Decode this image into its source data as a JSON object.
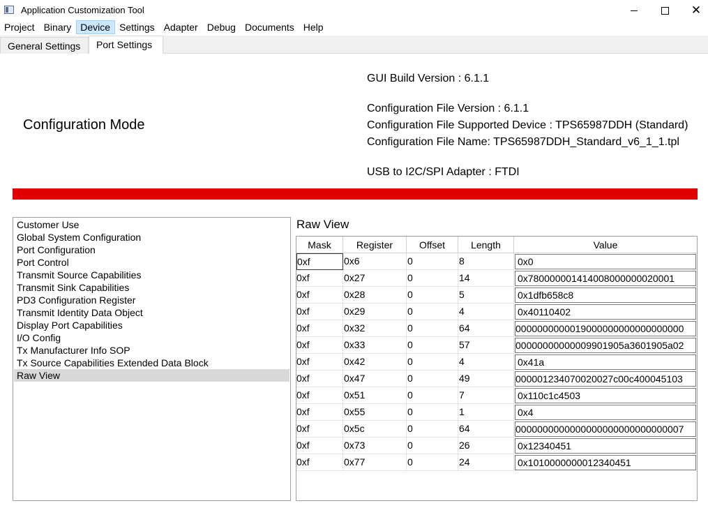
{
  "window": {
    "title": "Application Customization Tool",
    "icon": "app-window-icon",
    "controls": {
      "minimize": "minimize-icon",
      "maximize": "maximize-icon",
      "close": "✕"
    }
  },
  "menu": [
    "Project",
    "Binary",
    "Device",
    "Settings",
    "Adapter",
    "Debug",
    "Documents",
    "Help"
  ],
  "tabs": [
    "General Settings",
    "Port Settings"
  ],
  "header": {
    "config_mode": "Configuration Mode",
    "gui_build": "GUI Build Version : 6.1.1",
    "config_version": "Configuration File Version : 6.1.1",
    "supported_device": "Configuration File Supported Device : TPS65987DDH (Standard)",
    "file_name": "Configuration File Name: TPS65987DDH_Standard_v6_1_1.tpl",
    "adapter": "USB to I2C/SPI Adapter : FTDI",
    "status_color": "#e00000"
  },
  "nav_list": [
    "Customer Use",
    "Global System Configuration",
    "Port Configuration",
    "Port Control",
    "Transmit Source Capabilities",
    "Transmit Sink Capabilities",
    "PD3 Configuration Register",
    "Transmit Identity Data Object",
    "Display Port Capabilities",
    "I/O Config",
    "Tx Manufacturer Info SOP",
    "Tx Source Capabilities Extended Data Block",
    "Raw View"
  ],
  "selected_nav": "Raw View",
  "raw_view": {
    "title": "Raw View",
    "columns": [
      "Mask",
      "Register",
      "Offset",
      "Length",
      "Value"
    ],
    "rows": [
      {
        "mask": "0xf",
        "register": "0x6",
        "offset": "0",
        "length": "8",
        "value": "0x0"
      },
      {
        "mask": "0xf",
        "register": "0x27",
        "offset": "0",
        "length": "14",
        "value": "0x780000001414008000000020001"
      },
      {
        "mask": "0xf",
        "register": "0x28",
        "offset": "0",
        "length": "5",
        "value": "0x1dfb658c8"
      },
      {
        "mask": "0xf",
        "register": "0x29",
        "offset": "0",
        "length": "4",
        "value": "0x40110402"
      },
      {
        "mask": "0xf",
        "register": "0x32",
        "offset": "0",
        "length": "64",
        "value": "0000000000019000000000000000000"
      },
      {
        "mask": "0xf",
        "register": "0x33",
        "offset": "0",
        "length": "57",
        "value": "00000000000009901905a3601905a02"
      },
      {
        "mask": "0xf",
        "register": "0x42",
        "offset": "0",
        "length": "4",
        "value": "0x41a"
      },
      {
        "mask": "0xf",
        "register": "0x47",
        "offset": "0",
        "length": "49",
        "value": "000001234070020027c00c400045103"
      },
      {
        "mask": "0xf",
        "register": "0x51",
        "offset": "0",
        "length": "7",
        "value": "0x110c1c4503"
      },
      {
        "mask": "0xf",
        "register": "0x55",
        "offset": "0",
        "length": "1",
        "value": "0x4"
      },
      {
        "mask": "0xf",
        "register": "0x5c",
        "offset": "0",
        "length": "64",
        "value": "0000000000000000000000000000007"
      },
      {
        "mask": "0xf",
        "register": "0x73",
        "offset": "0",
        "length": "26",
        "value": "0x12340451"
      },
      {
        "mask": "0xf",
        "register": "0x77",
        "offset": "0",
        "length": "24",
        "value": "0x1010000000012340451"
      }
    ]
  }
}
